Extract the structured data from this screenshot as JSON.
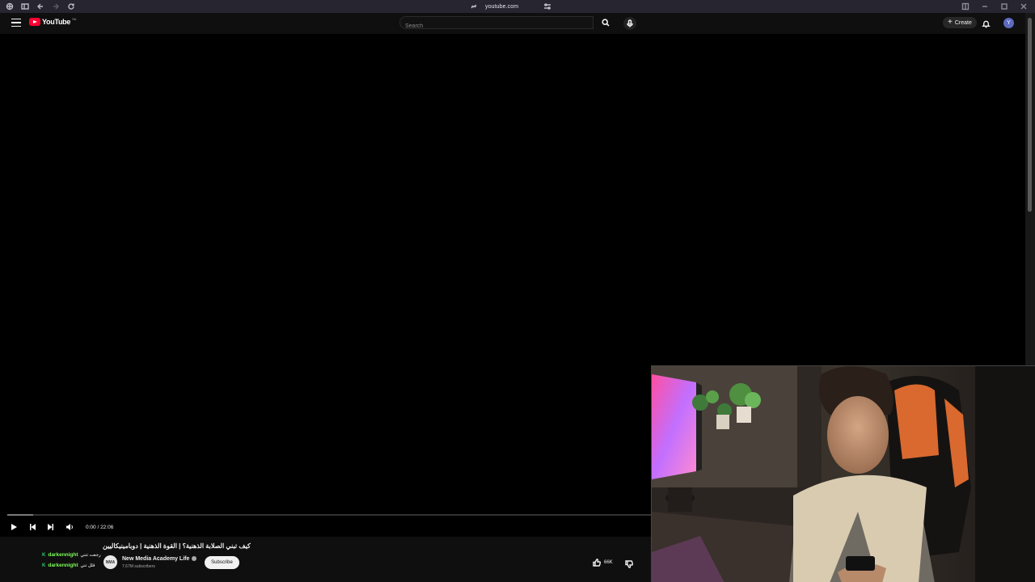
{
  "browser": {
    "url": "youtube.com"
  },
  "header": {
    "logo_text": "YouTube",
    "region": "SA",
    "search_placeholder": "Search",
    "create_label": "Create",
    "avatar_letter": "Y"
  },
  "player": {
    "time": "0:00 / 22:06",
    "progress_loaded": 0.04
  },
  "video": {
    "title": "كيف تبني الصلابة الذهنية؟ | القوة الذهنية | دوبامينيكاليين",
    "channel_name": "New Media Academy Life",
    "subscribers": "7.67M subscribers",
    "subscribe_label": "Subscribe",
    "likes": "66K"
  },
  "chat": [
    {
      "user": "darkennight",
      "message": "رجعت تتني"
    },
    {
      "user": "darkennight",
      "message": "قلل تني"
    }
  ],
  "colors": {
    "background": "#0f0f0f",
    "youtube_red": "#ff0033",
    "chat_user": "#7cfc5a"
  }
}
